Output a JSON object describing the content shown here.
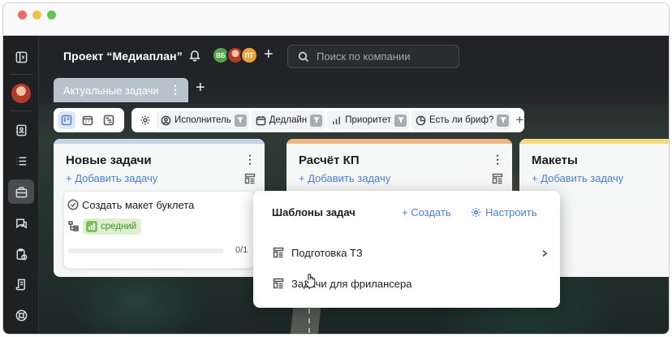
{
  "window": {
    "controls": [
      "close",
      "minimize",
      "maximize"
    ]
  },
  "sidebar": {
    "items": [
      {
        "icon": "sidebar-toggle-icon"
      },
      {
        "icon": "user-avatar"
      },
      {
        "icon": "contacts-icon"
      },
      {
        "icon": "list-icon"
      },
      {
        "icon": "briefcase-icon",
        "active": true
      },
      {
        "icon": "chat-icon"
      },
      {
        "icon": "clipboard-clock-icon"
      },
      {
        "icon": "document-icon"
      },
      {
        "icon": "support-icon"
      }
    ]
  },
  "header": {
    "project_title": "Проект “Медиаплан”",
    "members": [
      {
        "initials": "ВБ",
        "color": "#52a447"
      },
      {
        "initials": "",
        "color": "#b23a2b"
      },
      {
        "initials": "ПТ",
        "color": "#e8a33a"
      }
    ],
    "search_placeholder": "Поиск по компании"
  },
  "tabs": [
    {
      "label": "Актуальные задачи",
      "active": true
    }
  ],
  "filters": {
    "chips": [
      {
        "label": "Исполнитель",
        "icon": "person-icon"
      },
      {
        "label": "Дедлайн",
        "icon": "calendar-icon"
      },
      {
        "label": "Приоритет",
        "icon": "bars-icon"
      },
      {
        "label": "Есть ли бриф?",
        "icon": "pie-icon"
      }
    ]
  },
  "columns": [
    {
      "title": "Новые задачи",
      "band_color": "#c7d3e6",
      "add_label": "+ Добавить задачу",
      "cards": [
        {
          "name": "Создать макет буклета",
          "priority": "средний",
          "progress_text": "0/1",
          "progress": 0
        }
      ]
    },
    {
      "title": "Расчёт КП",
      "band_color": "#f0b481",
      "add_label": "+ Добавить задачу"
    },
    {
      "title": "Макеты",
      "band_color": "#f6d97a",
      "add_label": "+ Добавить задачу"
    }
  ],
  "templates_menu": {
    "title": "Шаблоны задач",
    "create_label": "+ Создать",
    "settings_label": "Настроить",
    "items": [
      {
        "label": "Подготовка ТЗ",
        "has_submenu": true
      },
      {
        "label": "Задачи для фрилансера",
        "has_submenu": false
      }
    ]
  },
  "colors": {
    "accent": "#4b7fd6",
    "sidebar_bg": "#1f2022",
    "priority_bg": "#dff0d2",
    "priority_fg": "#3f8f2b"
  }
}
